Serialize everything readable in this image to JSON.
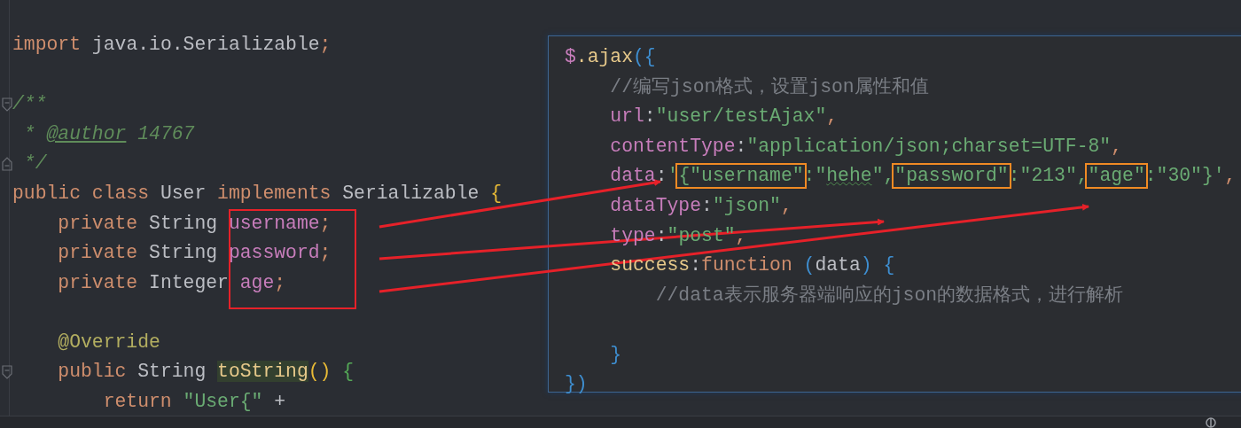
{
  "editor": {
    "lines": [
      {
        "kind": "code",
        "tokens": [
          {
            "kind": "keyword",
            "text": "import"
          },
          {
            "kind": "text",
            "text": " java.io.Serializable"
          },
          {
            "kind": "keyword",
            "text": ";"
          }
        ]
      },
      {
        "kind": "blank"
      },
      {
        "kind": "code",
        "fold_start": true,
        "tokens": [
          {
            "kind": "doc",
            "text": "/**"
          }
        ]
      },
      {
        "kind": "code",
        "tokens": [
          {
            "kind": "doc",
            "text": " * "
          },
          {
            "kind": "doctag",
            "text": "@author"
          },
          {
            "kind": "doc",
            "text": " 14767"
          }
        ]
      },
      {
        "kind": "code",
        "fold_end": true,
        "tokens": [
          {
            "kind": "doc",
            "text": " */"
          }
        ]
      },
      {
        "kind": "code",
        "tokens": [
          {
            "kind": "keyword",
            "text": "public class "
          },
          {
            "kind": "text",
            "text": "User "
          },
          {
            "kind": "keyword",
            "text": "implements "
          },
          {
            "kind": "text",
            "text": "Serializable "
          },
          {
            "kind": "bracket_yellow",
            "text": "{"
          }
        ]
      },
      {
        "kind": "code",
        "tokens": [
          {
            "kind": "keyword",
            "text": "    private "
          },
          {
            "kind": "text",
            "text": "String "
          },
          {
            "kind": "field",
            "text": "username"
          },
          {
            "kind": "keyword",
            "text": ";"
          }
        ]
      },
      {
        "kind": "code",
        "tokens": [
          {
            "kind": "keyword",
            "text": "    private "
          },
          {
            "kind": "text",
            "text": "String "
          },
          {
            "kind": "field",
            "text": "password"
          },
          {
            "kind": "keyword",
            "text": ";"
          }
        ]
      },
      {
        "kind": "code",
        "tokens": [
          {
            "kind": "keyword",
            "text": "    private "
          },
          {
            "kind": "text",
            "text": "Integer "
          },
          {
            "kind": "field",
            "text": "age"
          },
          {
            "kind": "keyword",
            "text": ";"
          }
        ]
      },
      {
        "kind": "blank"
      },
      {
        "kind": "code",
        "tokens": [
          {
            "kind": "annotation",
            "text": "    @Override"
          }
        ]
      },
      {
        "kind": "code",
        "fold_start": true,
        "tokens": [
          {
            "kind": "keyword",
            "text": "    public "
          },
          {
            "kind": "text",
            "text": "String "
          },
          {
            "kind": "method_usage",
            "text": "toString"
          },
          {
            "kind": "bracket_yellow",
            "text": "()"
          },
          {
            "kind": "bracket_green",
            "text": " {"
          }
        ]
      },
      {
        "kind": "code",
        "tokens": [
          {
            "kind": "keyword",
            "text": "        return "
          },
          {
            "kind": "string",
            "text": "\"User{\""
          },
          {
            "kind": "text",
            "text": " +"
          }
        ]
      }
    ]
  },
  "popup": {
    "lines": [
      {
        "kind": "code",
        "tokens": [
          {
            "kind": "prop",
            "text": "$"
          },
          {
            "kind": "method",
            "text": ".ajax"
          },
          {
            "kind": "bracket_blue",
            "text": "({"
          }
        ]
      },
      {
        "kind": "code",
        "tokens": [
          {
            "kind": "comment",
            "text": "    //编写json格式，设置json属性和值"
          }
        ]
      },
      {
        "kind": "code",
        "tokens": [
          {
            "kind": "prop",
            "text": "    url"
          },
          {
            "kind": "text",
            "text": ":"
          },
          {
            "kind": "string",
            "text": "\"user/testAjax\""
          },
          {
            "kind": "keyword",
            "text": ","
          }
        ]
      },
      {
        "kind": "code",
        "tokens": [
          {
            "kind": "prop",
            "text": "    contentType"
          },
          {
            "kind": "text",
            "text": ":"
          },
          {
            "kind": "string",
            "text": "\"application/json;charset=UTF-8\""
          },
          {
            "kind": "keyword",
            "text": ","
          }
        ]
      },
      {
        "kind": "code",
        "tokens": [
          {
            "kind": "prop",
            "text": "    data"
          },
          {
            "kind": "text",
            "text": ":"
          },
          {
            "kind": "string",
            "text": "'"
          },
          {
            "kind": "string",
            "text": "{\"username\"",
            "boxed": true
          },
          {
            "kind": "string",
            "text": ":\""
          },
          {
            "kind": "typo",
            "text": "hehe"
          },
          {
            "kind": "string",
            "text": "\","
          },
          {
            "kind": "string",
            "text": "\"password\"",
            "boxed": true
          },
          {
            "kind": "string",
            "text": ":\"213\","
          },
          {
            "kind": "string",
            "text": "\"age\"",
            "boxed": true
          },
          {
            "kind": "string",
            "text": ":\"30\"}'"
          },
          {
            "kind": "keyword",
            "text": ","
          }
        ]
      },
      {
        "kind": "code",
        "tokens": [
          {
            "kind": "prop",
            "text": "    dataType"
          },
          {
            "kind": "text",
            "text": ":"
          },
          {
            "kind": "string",
            "text": "\"json\""
          },
          {
            "kind": "keyword",
            "text": ","
          }
        ]
      },
      {
        "kind": "code",
        "tokens": [
          {
            "kind": "prop",
            "text": "    type"
          },
          {
            "kind": "text",
            "text": ":"
          },
          {
            "kind": "string",
            "text": "\"post\""
          },
          {
            "kind": "keyword",
            "text": ","
          }
        ]
      },
      {
        "kind": "code",
        "tokens": [
          {
            "kind": "method",
            "text": "    success"
          },
          {
            "kind": "text",
            "text": ":"
          },
          {
            "kind": "keyword",
            "text": "function "
          },
          {
            "kind": "bracket_blue",
            "text": "("
          },
          {
            "kind": "text",
            "text": "data"
          },
          {
            "kind": "bracket_blue",
            "text": ")"
          },
          {
            "kind": "bracket_blue",
            "text": " {"
          }
        ]
      },
      {
        "kind": "code",
        "tokens": [
          {
            "kind": "comment",
            "text": "        //data表示服务器端响应的json的数据格式，进行解析"
          }
        ]
      },
      {
        "kind": "blank"
      },
      {
        "kind": "code",
        "tokens": [
          {
            "kind": "bracket_blue",
            "text": "    }"
          }
        ]
      },
      {
        "kind": "code",
        "tokens": [
          {
            "kind": "bracket_blue",
            "text": "})"
          }
        ]
      }
    ]
  }
}
